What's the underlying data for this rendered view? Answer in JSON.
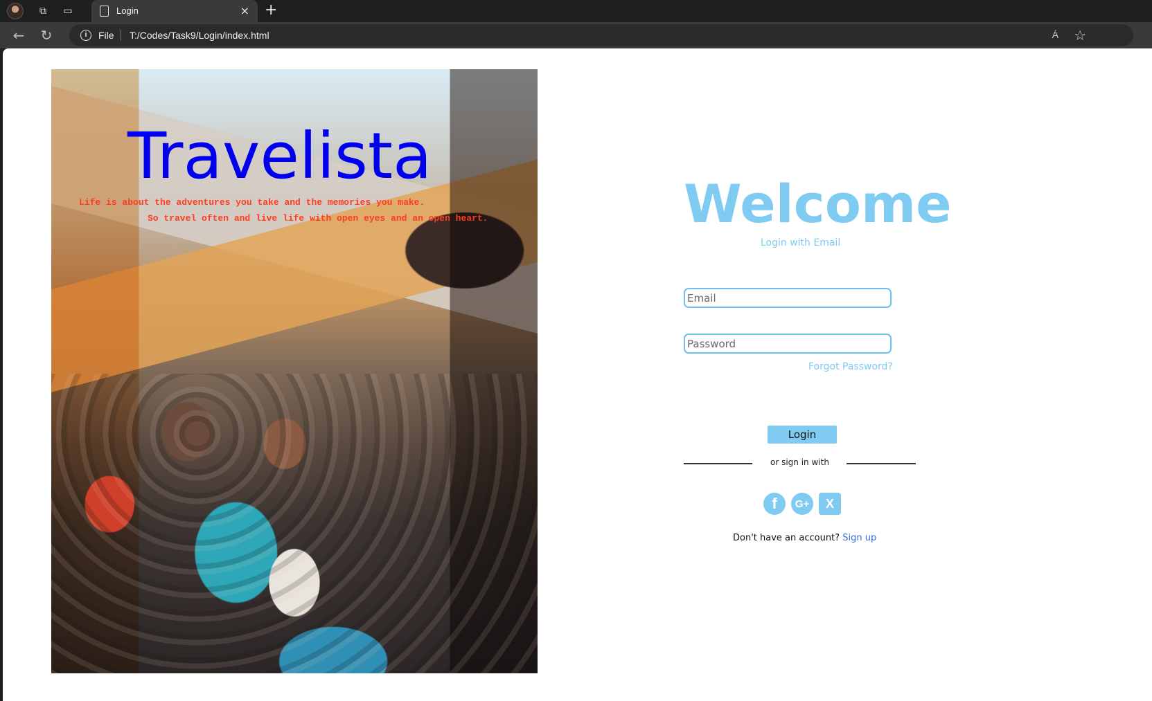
{
  "browser": {
    "tab_title": "Login",
    "tab_close": "×",
    "new_tab": "+",
    "file_label": "File",
    "url": "T:/Codes/Task9/Login/index.html",
    "read_aloud": "Á"
  },
  "hero": {
    "brand": "Travelista",
    "tagline_line1": "Life is about the adventures you take and the memories you make.",
    "tagline_line2": "So travel often and live life with open eyes and an open heart."
  },
  "login": {
    "welcome": "Welcome",
    "subtitle": "Login with Email",
    "email_placeholder": "Email",
    "password_placeholder": "Password",
    "forgot": "Forgot Password?",
    "button": "Login",
    "or_text": "or sign in with",
    "social": [
      {
        "icon": "facebook-icon",
        "glyph": "f"
      },
      {
        "icon": "google-plus-icon",
        "glyph": "G+"
      },
      {
        "icon": "x-icon",
        "glyph": "X"
      }
    ],
    "no_account": "Don't have an account?",
    "signup": "Sign up"
  },
  "colors": {
    "accent": "#7fcbf2",
    "brand": "#0000ee",
    "tagline": "#ff3b1f",
    "link": "#2f6fd6"
  }
}
